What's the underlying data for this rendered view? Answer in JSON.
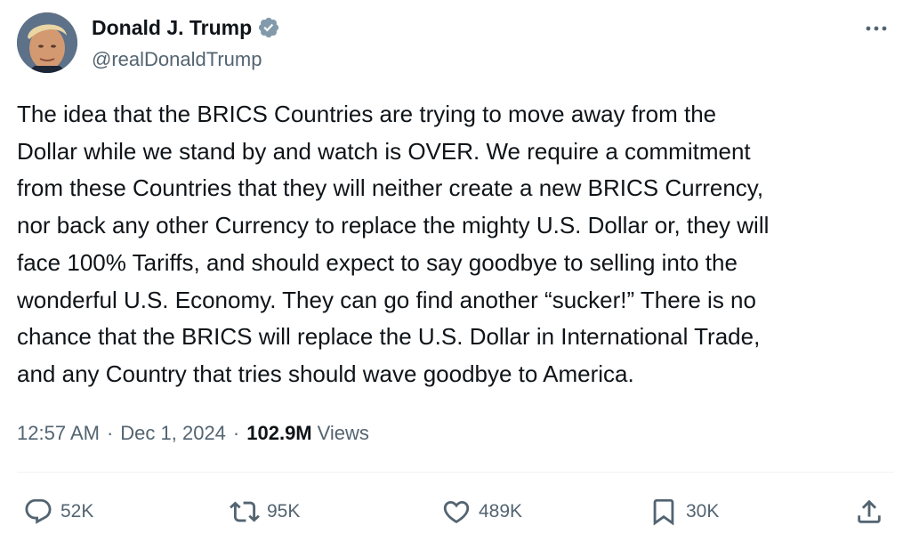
{
  "author": {
    "name": "Donald J. Trump",
    "handle": "@realDonaldTrump",
    "verified": true
  },
  "post": {
    "text": "The idea that the BRICS Countries are trying to move away from the\nDollar while we stand by and watch is OVER. We require a commitment\nfrom these Countries that they will neither create a new BRICS Currency,\nnor back any other Currency to replace the mighty U.S. Dollar or, they will\nface 100% Tariffs, and should expect to say goodbye to selling into the\nwonderful U.S. Economy. They can go find another “sucker!” There is no\nchance that the BRICS will replace the U.S. Dollar in International Trade,\nand any Country that tries should wave goodbye to America.",
    "time": "12:57 AM",
    "separator": "·",
    "date": "Dec 1, 2024",
    "views_count": "102.9M",
    "views_label": "Views"
  },
  "actions": {
    "replies": "52K",
    "reposts": "95K",
    "likes": "489K",
    "bookmarks": "30K"
  },
  "icons": {
    "verified": "verified-badge-icon",
    "more": "more-horizontal-icon",
    "reply": "reply-icon",
    "repost": "repost-icon",
    "like": "heart-icon",
    "bookmark": "bookmark-icon",
    "share": "share-icon"
  },
  "colors": {
    "text": "#0f1419",
    "secondary": "#536471",
    "verified": "#829aab",
    "divider": "#eff3f4"
  }
}
